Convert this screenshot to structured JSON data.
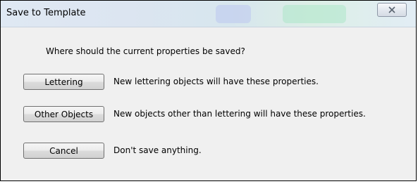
{
  "window": {
    "title": "Save to Template",
    "close_glyph": "✕"
  },
  "dialog": {
    "question": "Where should the current properties be saved?",
    "options": [
      {
        "button_label": "Lettering",
        "description": "New lettering objects will have these properties."
      },
      {
        "button_label": "Other Objects",
        "description": "New objects other than lettering will have these properties."
      },
      {
        "button_label": "Cancel",
        "description": "Don't save anything."
      }
    ]
  },
  "colors": {
    "titlebar": "#dce5f1",
    "client_background": "#f0f0f0",
    "button_border": "#707070"
  },
  "icons": {
    "close": "close-icon"
  }
}
